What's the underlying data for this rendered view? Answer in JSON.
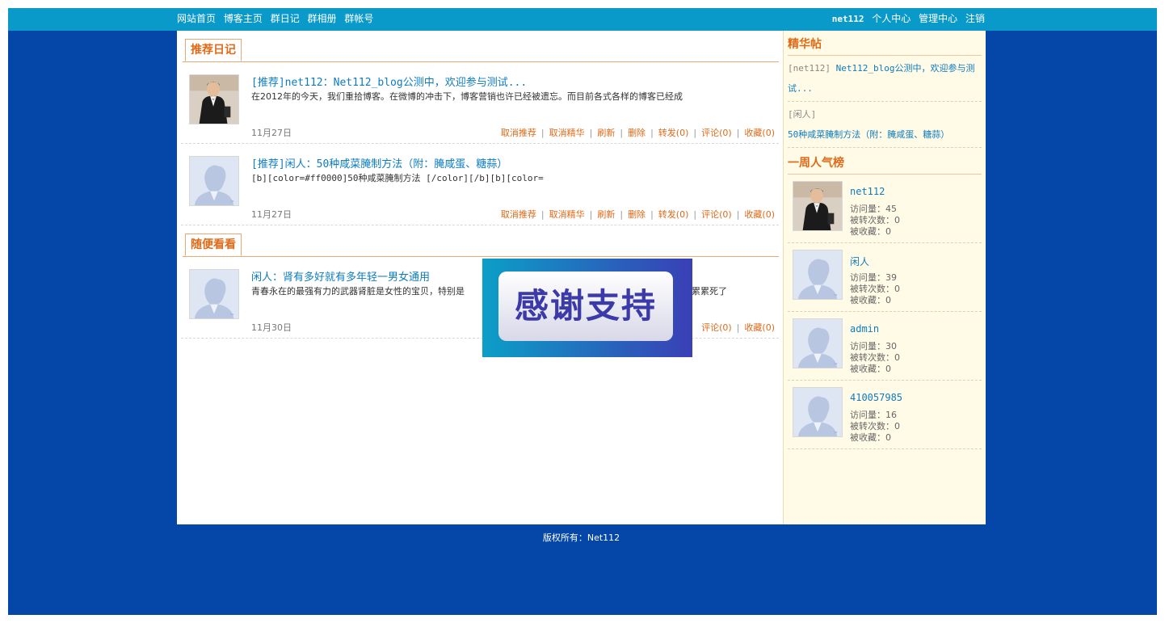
{
  "topnav": {
    "items": [
      "网站首页",
      "博客主页",
      "群日记",
      "群相册",
      "群帐号"
    ]
  },
  "userbar": {
    "username": "net112",
    "links": [
      "个人中心",
      "管理中心",
      "注销"
    ]
  },
  "sections": {
    "recommended_title": "推荐日记",
    "random_title": "随便看看"
  },
  "recommended_posts": [
    {
      "title": "[推荐]net112：Net112_blog公测中，欢迎参与测试...",
      "excerpt": "在2012年的今天，我们重拾博客。在微博的冲击下，博客营销也许已经被遗忘。而目前各式各样的博客已经成",
      "date": "11月27日",
      "avatar": "man-photo-avatar"
    },
    {
      "title": "[推荐]闲人：50种咸菜腌制方法（附：腌咸蛋、糖蒜）",
      "excerpt": "[b][color=#ff0000]50种咸菜腌制方法  [/color][/b][b][color=",
      "date": "11月27日",
      "avatar": "default-avatar"
    }
  ],
  "random_posts": [
    {
      "title": "闲人：肾有多好就有多年轻一男女通用",
      "excerpt": "青春永在的最强有力的武器肾脏是女性的宝贝，特别是",
      "excerpt_tail": "累累死了",
      "date": "11月30日",
      "avatar": "default-avatar"
    }
  ],
  "post_actions": {
    "cancel_recommend": "取消推荐",
    "cancel_featured": "取消精华",
    "refresh": "刷新",
    "delete": "删除",
    "forward": "转发(0)",
    "comment": "评论(0)",
    "favorite": "收藏(0)"
  },
  "sidebar": {
    "featured_title": "精华帖",
    "featured": [
      {
        "tag": "[net112]",
        "text": "Net112_blog公测中，欢迎参与测试..."
      },
      {
        "tag": "[闲人]",
        "text": "50种咸菜腌制方法（附：腌咸蛋、糖蒜）"
      }
    ],
    "ranking_title": "一周人气榜",
    "ranking": [
      {
        "name": "net112",
        "visits": "访问量：45",
        "forwarded": "被转次数：0",
        "favorited": "被收藏：0",
        "avatar": "man-photo-avatar"
      },
      {
        "name": "闲人",
        "visits": "访问量：39",
        "forwarded": "被转次数：0",
        "favorited": "被收藏：0",
        "avatar": "default-avatar"
      },
      {
        "name": "admin",
        "visits": "访问量：30",
        "forwarded": "被转次数：0",
        "favorited": "被收藏：0",
        "avatar": "default-avatar"
      },
      {
        "name": "410057985",
        "visits": "访问量：16",
        "forwarded": "被转次数：0",
        "favorited": "被收藏：0",
        "avatar": "default-avatar"
      }
    ]
  },
  "footer": {
    "text": "版权所有：Net112"
  },
  "banner": {
    "text": "感谢支持"
  },
  "colors": {
    "page_bg": "#0547a8",
    "topbar": "#0a9ac9",
    "accent_orange": "#e06a18",
    "link_blue": "#0d7cc1",
    "sidebar_bg": "#fffbe6"
  }
}
